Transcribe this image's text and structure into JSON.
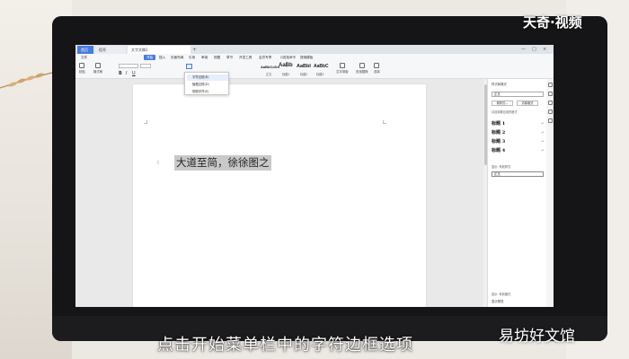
{
  "window": {
    "tabs": [
      "首页",
      "稻壳",
      "文字文稿1"
    ],
    "controls": [
      "—",
      "□",
      "×"
    ]
  },
  "menubar": {
    "items": [
      "文件",
      "开始",
      "插入",
      "页面布局",
      "引用",
      "审阅",
      "视图",
      "章节",
      "开发工具",
      "会员专享",
      "Q查找命令",
      "搜索模板"
    ],
    "active": "开始"
  },
  "toolbar": {
    "left_buttons": [
      "粘贴",
      "格式刷"
    ],
    "style_previews": [
      "AaBbCcDd",
      "AaBb",
      "AaBbI",
      "AaBbC"
    ],
    "style_captions": [
      "正文",
      "标题1",
      "标题2",
      "标题3"
    ],
    "right_buttons": [
      "文字排版",
      "查找替换",
      "选择"
    ]
  },
  "dropdown": {
    "items": [
      "字符边框(B)",
      "隐藏边框(D)",
      "带圈字符(E)"
    ],
    "highlighted_index": 0
  },
  "document": {
    "selected_text": "大道至简，徐徐图之"
  },
  "right_panel": {
    "title": "样式和格式",
    "current_style": "正文",
    "buttons": [
      "新样式...",
      "清除格式"
    ],
    "sub_label": "请选择要应用的格式",
    "styles": [
      "标题 1",
      "标题 2",
      "标题 3",
      "标题 4"
    ],
    "show_label": "显示: 有效样式",
    "show_value": "正文",
    "footer_label": "显示: 有效格式",
    "footer_option": "显示预览"
  },
  "overlays": {
    "brand": "天奇·视频",
    "subtitle": "点击开始菜单栏中的字符边框选项",
    "watermark": "易坊好文馆"
  }
}
